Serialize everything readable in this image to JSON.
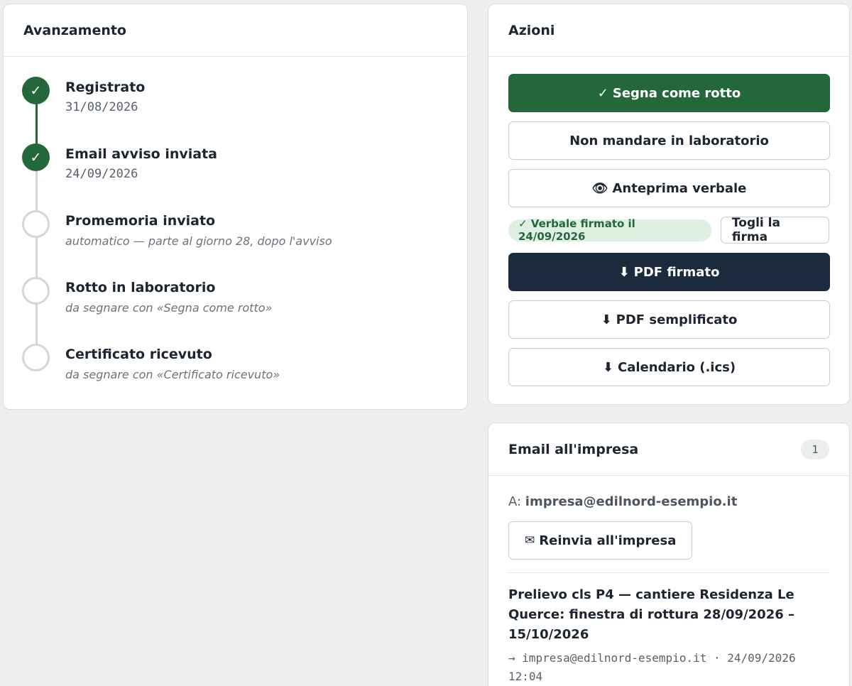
{
  "progress": {
    "title": "Avanzamento",
    "steps": [
      {
        "label": "Registrato",
        "sub": "31/08/2026",
        "status": "done",
        "icon": "check-icon",
        "check": "✓"
      },
      {
        "label": "Email avviso inviata",
        "sub": "24/09/2026",
        "status": "done",
        "icon": "check-icon",
        "check": "✓"
      },
      {
        "label": "Promemoria inviato",
        "sub": "automatico — parte al giorno 28, dopo l'avviso",
        "status": "pending"
      },
      {
        "label": "Rotto in laboratorio",
        "sub": "da segnare con «Segna come rotto»",
        "status": "pending"
      },
      {
        "label": "Certificato ricevuto",
        "sub": "da segnare con «Certificato ricevuto»",
        "status": "pending"
      }
    ]
  },
  "actions": {
    "title": "Azioni",
    "mark_broken": {
      "icon_char": "✓",
      "label": "Segna come rotto"
    },
    "no_lab": {
      "label": "Non mandare in laboratorio"
    },
    "preview": {
      "icon_char": "👁",
      "label": "Anteprima verbale"
    },
    "signed_badge": "✓ Verbale firmato il 24/09/2026",
    "remove_signature": "Togli la firma",
    "pdf_signed": {
      "icon_char": "⬇",
      "label": "PDF firmato"
    },
    "pdf_simple": {
      "icon_char": "⬇",
      "label": "PDF semplificato"
    },
    "calendar": {
      "icon_char": "⬇",
      "label": "Calendario (.ics)"
    }
  },
  "email": {
    "title": "Email all'impresa",
    "count": "1",
    "to_label": "A:",
    "to_address": "impresa@edilnord-esempio.it",
    "resend": {
      "icon_char": "✉",
      "label": "Reinvia all'impresa"
    },
    "messages": [
      {
        "subject": "Prelievo cls P4 — cantiere Residenza Le Querce: finestra di rottura 28/09/2026 – 15/10/2026",
        "meta": "→ impresa@edilnord-esempio.it · 24/09/2026 12:04"
      }
    ]
  },
  "colors": {
    "accent_green": "#24673a",
    "dark_button": "#1c2a3e",
    "badge_green_bg": "#dff0e2",
    "page_bg": "#eeefec"
  }
}
